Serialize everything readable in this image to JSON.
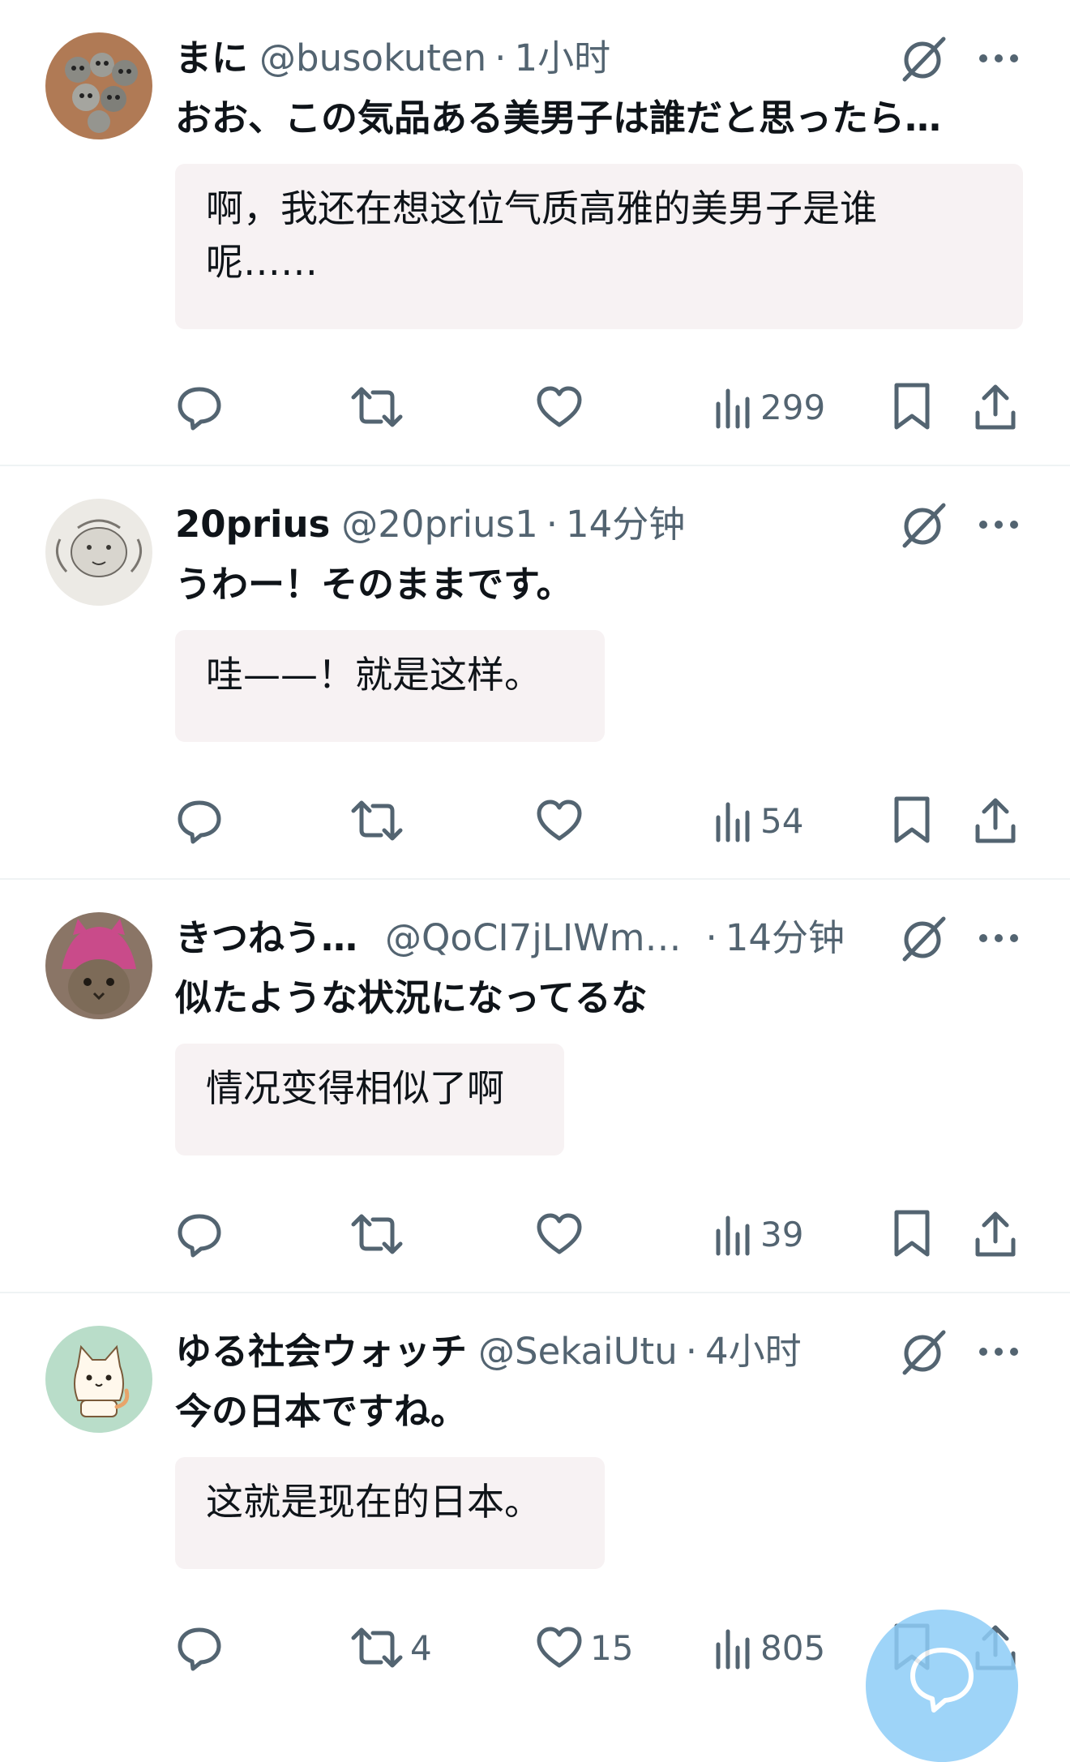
{
  "colors": {
    "text": "#0f1419",
    "muted": "#536471",
    "translation_bg": "#f7f2f3",
    "fab": "#8ecdf7"
  },
  "posts": [
    {
      "name": "まに",
      "handle": "@busokuten",
      "separator": "·",
      "time": "1小时",
      "text": "おお、この気品ある美男子は誰だと思ったら…",
      "translation_line1": "啊，我还在想这位气质高雅的美男子是谁",
      "translation_line2": "呢……",
      "views": "299",
      "retweets": "",
      "likes": "",
      "avatar_icon": "owl-figurines-avatar"
    },
    {
      "name": "20prius",
      "handle": "@20prius1",
      "separator": "·",
      "time": "14分钟",
      "text": "うわー！そのままです。",
      "translation_line1": "哇——！就是这样。",
      "views": "54",
      "retweets": "",
      "likes": "",
      "avatar_icon": "cherub-sketch-avatar"
    },
    {
      "name": "きつねう…",
      "handle": "@QoCI7jLIWm…",
      "separator": "·",
      "time": "14分钟",
      "text": "似たような状況になってるな",
      "translation_line1": "情况变得相似了啊",
      "views": "39",
      "retweets": "",
      "likes": "",
      "avatar_icon": "cat-in-pink-hat-avatar"
    },
    {
      "name": "ゆる社会ウォッチ",
      "handle": "@SekaiUtu",
      "separator": "·",
      "time": "4小时",
      "text": "今の日本ですね。",
      "translation_line1": "这就是现在的日本。",
      "views": "805",
      "retweets": "4",
      "likes": "15",
      "avatar_icon": "cartoon-cat-avatar"
    }
  ],
  "icons": {
    "reply": "reply-icon",
    "retweet": "retweet-icon",
    "like": "like-icon",
    "views": "views-icon",
    "bookmark": "bookmark-icon",
    "share": "share-icon",
    "grok": "grok-icon",
    "more": "more-icon",
    "compose": "compose-fab-icon"
  }
}
